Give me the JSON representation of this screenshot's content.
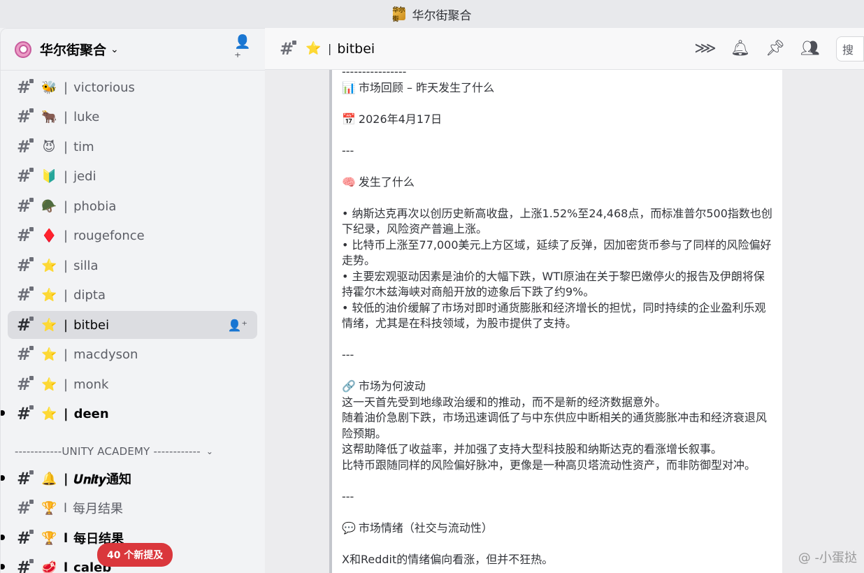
{
  "window": {
    "title": "华尔街聚合",
    "app_icon": "华尔街"
  },
  "server": {
    "name": "华尔街聚合"
  },
  "channels": [
    {
      "emoji": "🐝",
      "name": "victorious"
    },
    {
      "emoji": "🐂",
      "name": "luke"
    },
    {
      "emoji": "😈",
      "name": "tim"
    },
    {
      "emoji": "🔰",
      "name": "jedi"
    },
    {
      "emoji": "🪖",
      "name": "phobia"
    },
    {
      "emoji": "♦️",
      "name": "rougefonce"
    },
    {
      "emoji": "⭐",
      "name": "silla"
    },
    {
      "emoji": "⭐",
      "name": "dipta"
    },
    {
      "emoji": "⭐",
      "name": "bitbei"
    },
    {
      "emoji": "⭐",
      "name": "macdyson"
    },
    {
      "emoji": "⭐",
      "name": "monk"
    },
    {
      "emoji": "⭐",
      "name": "deen"
    }
  ],
  "category": {
    "label": "------------UNITY ACADEMY ------------"
  },
  "category_channels": [
    {
      "emoji": "🔔",
      "name": "𝑼𝒏𝒊𝒕𝒚通知"
    },
    {
      "emoji": "🏆",
      "name": "每月结果"
    },
    {
      "emoji": "🏆",
      "name": "每日结果"
    },
    {
      "emoji": "🥩",
      "name": "caleb"
    }
  ],
  "new_mentions_badge": "40 个新提及",
  "current_channel": {
    "emoji": "⭐",
    "name": "bitbei"
  },
  "search": {
    "placeholder": "搜"
  },
  "message": {
    "divider": "----------------",
    "recap_title": "市场回顾 – 昨天发生了什么",
    "date": "2026年4月17日",
    "hr1": "---",
    "what_happened_title": "发生了什么",
    "bullet1": "• 纳斯达克再次以创历史新高收盘，上涨1.52%至24,468点，而标准普尔500指数也创下纪录，风险资产普遍上涨。",
    "bullet2": "• 比特币上涨至77,000美元上方区域，延续了反弹，因加密货币参与了同样的风险偏好走势。",
    "bullet3": "• 主要宏观驱动因素是油价的大幅下跌，WTI原油在关于黎巴嫩停火的报告及伊朗将保持霍尔木兹海峡对商船开放的迹象后下跌了约9%。",
    "bullet4": "• 较低的油价缓解了市场对即时通货膨胀和经济增长的担忧，同时持续的企业盈利乐观情绪，尤其是在科技领域，为股市提供了支持。",
    "hr2": "---",
    "why_title": "市场为何波动",
    "why1": "这一天首先受到地缘政治缓和的推动，而不是新的经济数据意外。",
    "why2": "随着油价急剧下跌，市场迅速调低了与中东供应中断相关的通货膨胀冲击和经济衰退风险预期。",
    "why3": "这帮助降低了收益率，并加强了支持大型科技股和纳斯达克的看涨增长叙事。",
    "why4": "比特币跟随同样的风险偏好脉冲，更像是一种高贝塔流动性资产，而非防御型对冲。",
    "hr3": "---",
    "sentiment_title": "市场情绪（社交与流动性）",
    "sentiment1": "X和Reddit的情绪偏向看涨，但并不狂热。"
  },
  "watermark": "@ -小蛋挞"
}
